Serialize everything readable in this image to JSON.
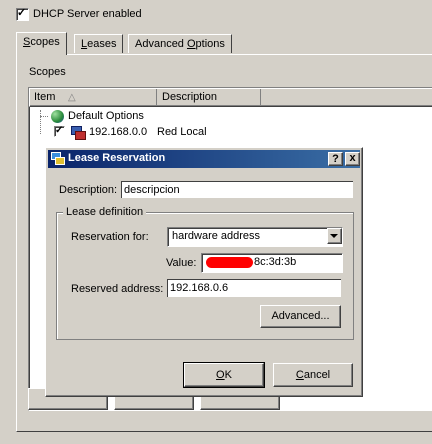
{
  "top": {
    "dhcp_label": "DHCP Server enabled"
  },
  "tabs": [
    {
      "label": "Scopes",
      "mnemonic": "S",
      "rest": "copes"
    },
    {
      "label": "Leases",
      "mnemonic": "L",
      "rest": "eases"
    },
    {
      "label": "Advanced Options",
      "pre": "Advanced ",
      "mnemonic": "O",
      "rest": "ptions"
    }
  ],
  "scopes": {
    "group_label": "Scopes",
    "columns": {
      "item": "Item",
      "description": "Description"
    },
    "rows": [
      {
        "name": "Default Options",
        "description": ""
      },
      {
        "name": "192.168.0.0",
        "description": "Red Local"
      }
    ]
  },
  "dialog": {
    "title": "Lease Reservation",
    "help_button": "?",
    "close_button": "x",
    "description_label": "Description:",
    "description_value": "descripcion",
    "lease_group_label": "Lease definition",
    "reservation_label": "Reservation for:",
    "reservation_value": "hardware address",
    "value_label": "Value:",
    "value_suffix": "8c:3d:3b",
    "reserved_label": "Reserved address:",
    "reserved_value": "192.168.0.6",
    "advanced_button": "Advanced...",
    "ok_button": "OK",
    "ok_mnemonic": "O",
    "ok_rest": "K",
    "cancel_button": "Cancel",
    "cancel_mnemonic": "C",
    "cancel_rest": "ancel"
  },
  "colors": {
    "titlebar": "#0a246a",
    "redaction": "#ff0000",
    "face": "#d4d0c8"
  }
}
